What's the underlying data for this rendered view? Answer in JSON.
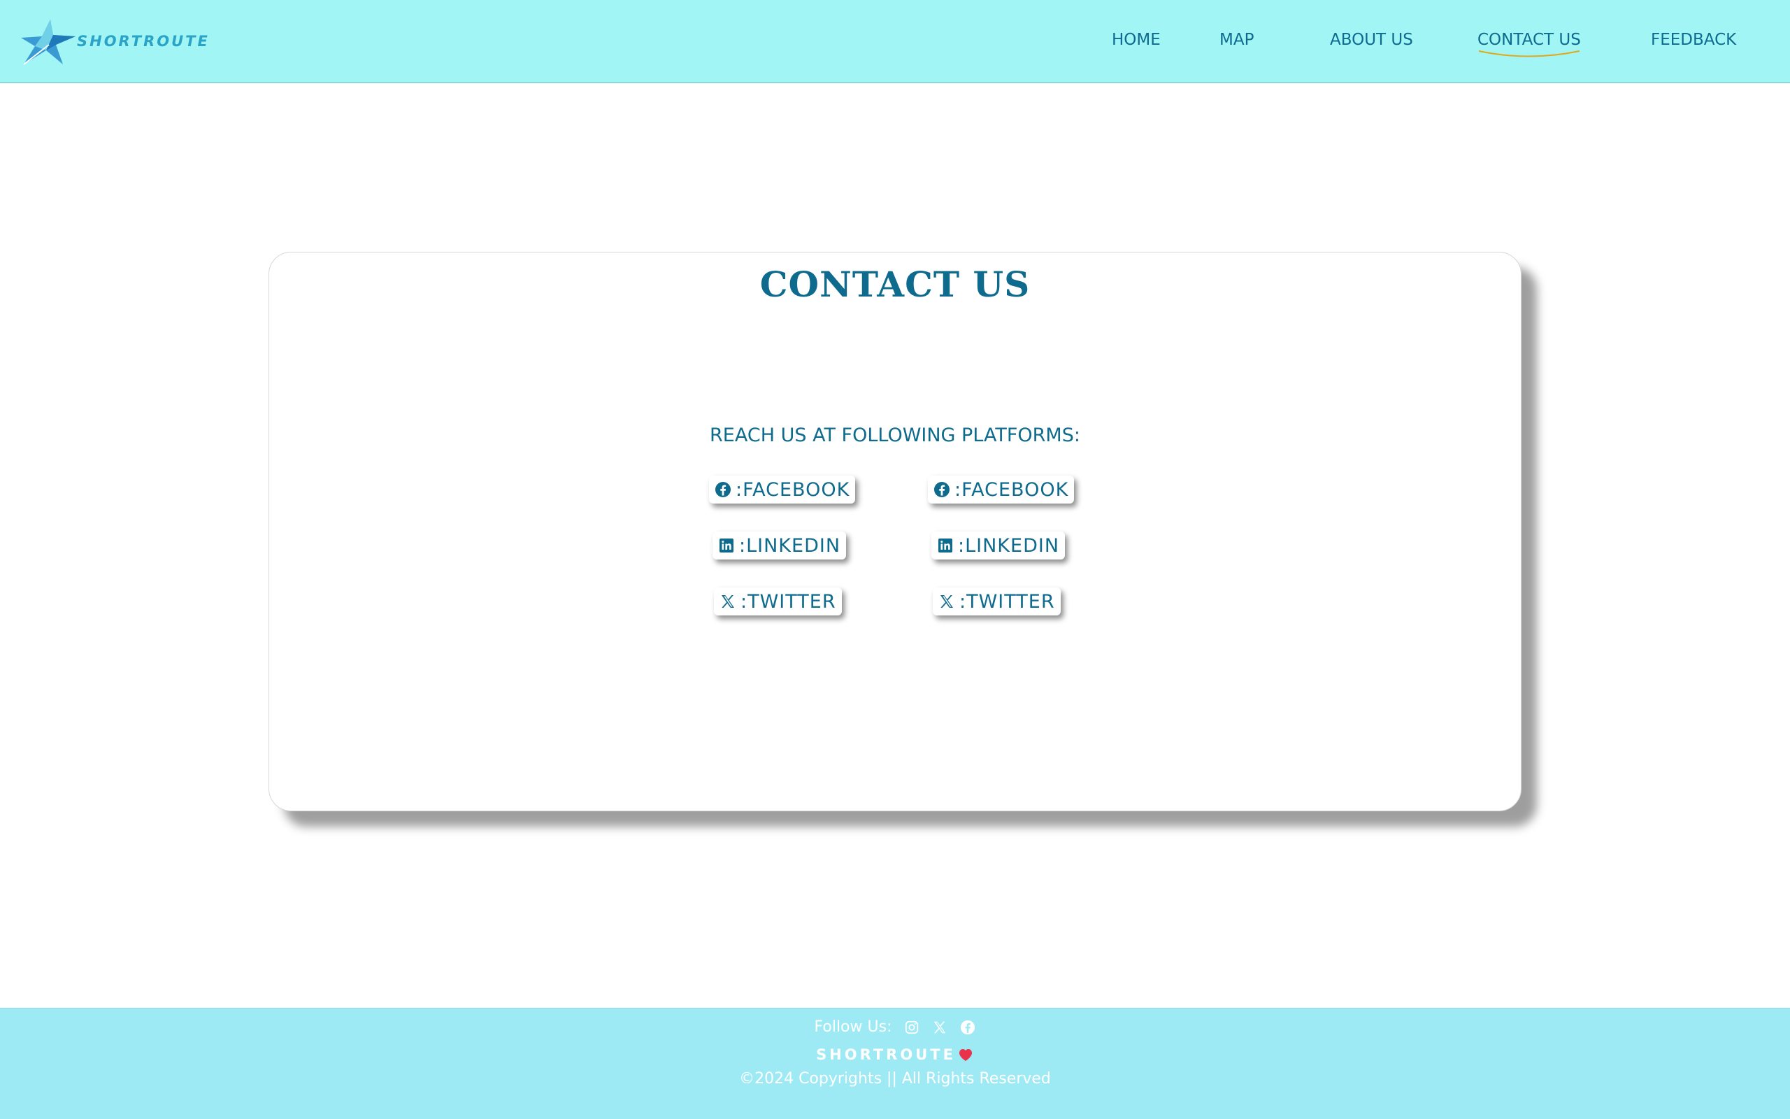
{
  "header": {
    "logo": {
      "word": "SHORTROUTE",
      "tagline": "—"
    },
    "nav": [
      {
        "label": "HOME"
      },
      {
        "label": "MAP"
      },
      {
        "label": "ABOUT US"
      },
      {
        "label": "CONTACT US",
        "active": true
      },
      {
        "label": "FEEDBACK"
      }
    ],
    "active_underline_color": "#e0a81a"
  },
  "main": {
    "title": "CONTACT US",
    "subtitle": "REACH US AT FOLLOWING PLATFORMS:",
    "platforms": [
      {
        "icon": "facebook-icon",
        "label": ":FACEBOOK"
      },
      {
        "icon": "facebook-icon",
        "label": ":FACEBOOK"
      },
      {
        "icon": "linkedin-icon",
        "label": ":LINKEDIN"
      },
      {
        "icon": "linkedin-icon",
        "label": ":LINKEDIN"
      },
      {
        "icon": "x-twitter-icon",
        "label": ":TWITTER"
      },
      {
        "icon": "x-twitter-icon",
        "label": ":TWITTER"
      }
    ]
  },
  "footer": {
    "follow_label": "Follow Us:",
    "follow_icons": [
      "instagram-icon",
      "x-twitter-icon",
      "facebook-icon"
    ],
    "brand": "SHORTROUTE",
    "copyright": "©2024 Copyrights || All Rights Reserved"
  },
  "colors": {
    "header_bg": "#a1f6f5",
    "footer_bg": "#9deaf5",
    "primary_text": "#0f6b8e",
    "heart": "#e8334a"
  }
}
